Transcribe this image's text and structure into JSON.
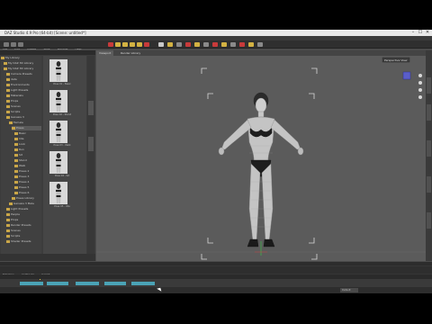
{
  "window": {
    "title": "DAZ Studio 4.9 Pro (64-bit) [Scene: untitled*]",
    "menu": [
      "File",
      "Edit",
      "Create",
      "Tools",
      "Window",
      "Help"
    ],
    "controls": [
      "–",
      "☐",
      "✕"
    ]
  },
  "toolbar": {
    "viewport_tabs": [
      "Viewport",
      "Render Library"
    ]
  },
  "left_panel": {
    "header": "Smart Content",
    "footer_tabs": [
      "Files",
      "Scene",
      "Tools"
    ],
    "tree": [
      {
        "label": "My Library",
        "indent": 0
      },
      {
        "label": "My DAZ 3D Library",
        "indent": 1
      },
      {
        "label": "My DAZ 3D Library",
        "indent": 1
      },
      {
        "label": "Camera Presets",
        "indent": 2
      },
      {
        "label": "data",
        "indent": 2
      },
      {
        "label": "Environments",
        "indent": 2
      },
      {
        "label": "Light Presets",
        "indent": 2
      },
      {
        "label": "Materials",
        "indent": 2
      },
      {
        "label": "Props",
        "indent": 2
      },
      {
        "label": "Scenes",
        "indent": 2
      },
      {
        "label": "Scripts",
        "indent": 2
      },
      {
        "label": "Genesis 3",
        "indent": 2
      },
      {
        "label": "Female",
        "indent": 3
      },
      {
        "label": "Poses",
        "indent": 4
      },
      {
        "label": "Basic",
        "indent": 5
      },
      {
        "label": "Idle",
        "indent": 5
      },
      {
        "label": "Look",
        "indent": 5
      },
      {
        "label": "Run",
        "indent": 5
      },
      {
        "label": "Sit",
        "indent": 5
      },
      {
        "label": "Stand",
        "indent": 5
      },
      {
        "label": "Walk",
        "indent": 5
      },
      {
        "label": "Poses 2",
        "indent": 5
      },
      {
        "label": "Poses 3",
        "indent": 5
      },
      {
        "label": "Poses 4",
        "indent": 5
      },
      {
        "label": "Poses 5",
        "indent": 5
      },
      {
        "label": "Poses 6",
        "indent": 5
      },
      {
        "label": "Poses Library",
        "indent": 4
      },
      {
        "label": "Genesis 3 Male",
        "indent": 3
      },
      {
        "label": "Light Presets",
        "indent": 2
      },
      {
        "label": "People",
        "indent": 2
      },
      {
        "label": "Props",
        "indent": 2
      },
      {
        "label": "Render Presets",
        "indent": 2
      },
      {
        "label": "Scenes",
        "indent": 2
      },
      {
        "label": "Scripts",
        "indent": 2
      },
      {
        "label": "Shader Presets",
        "indent": 2
      }
    ],
    "thumbnails": [
      {
        "label": "Pose 01 - Basic"
      },
      {
        "label": "Pose 02 - Stand"
      },
      {
        "label": "Pose 03 - Walk"
      },
      {
        "label": "Pose 04 - Sit"
      },
      {
        "label": "Pose 05 - Idle"
      }
    ]
  },
  "viewport": {
    "camera_selector": "Perspective View",
    "grid_color": "#d8d8d8",
    "bg_color": "#5b5b5b",
    "figure_icons": [
      "camera-icon",
      "orbit-icon",
      "zoom-icon",
      "pan-icon"
    ]
  },
  "timeline": {
    "header": "Timeline",
    "tabs": [
      "Timeline",
      "Aniblocks",
      "Graph"
    ],
    "track_label": "Genesis 3 Female",
    "start": "0",
    "end": "30"
  },
  "status": {
    "right_box": "Default Figure"
  },
  "colors": {
    "accent": "#e0c23b",
    "keyframe": "#4aa3b6",
    "panel": "#3c3c3c"
  }
}
